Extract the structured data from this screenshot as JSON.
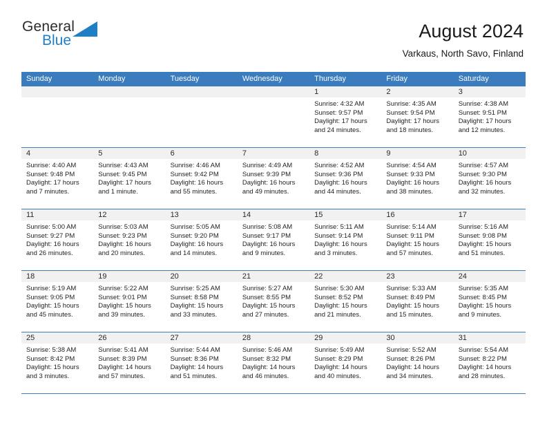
{
  "brand": {
    "name_top": "General",
    "name_bottom": "Blue",
    "triangle_color": "#1f7fc4",
    "text_color": "#2b2b2b"
  },
  "header": {
    "title": "August 2024",
    "subtitle": "Varkaus, North Savo, Finland"
  },
  "theme": {
    "header_blue": "#3a7cbe",
    "date_band_gray": "#f1f1f1",
    "row_border": "#3a7cbe"
  },
  "weekdays": [
    "Sunday",
    "Monday",
    "Tuesday",
    "Wednesday",
    "Thursday",
    "Friday",
    "Saturday"
  ],
  "weeks": [
    [
      {
        "empty": true
      },
      {
        "empty": true
      },
      {
        "empty": true
      },
      {
        "empty": true
      },
      {
        "date": "1",
        "sunrise": "Sunrise: 4:32 AM",
        "sunset": "Sunset: 9:57 PM",
        "daylight1": "Daylight: 17 hours",
        "daylight2": "and 24 minutes."
      },
      {
        "date": "2",
        "sunrise": "Sunrise: 4:35 AM",
        "sunset": "Sunset: 9:54 PM",
        "daylight1": "Daylight: 17 hours",
        "daylight2": "and 18 minutes."
      },
      {
        "date": "3",
        "sunrise": "Sunrise: 4:38 AM",
        "sunset": "Sunset: 9:51 PM",
        "daylight1": "Daylight: 17 hours",
        "daylight2": "and 12 minutes."
      }
    ],
    [
      {
        "date": "4",
        "sunrise": "Sunrise: 4:40 AM",
        "sunset": "Sunset: 9:48 PM",
        "daylight1": "Daylight: 17 hours",
        "daylight2": "and 7 minutes."
      },
      {
        "date": "5",
        "sunrise": "Sunrise: 4:43 AM",
        "sunset": "Sunset: 9:45 PM",
        "daylight1": "Daylight: 17 hours",
        "daylight2": "and 1 minute."
      },
      {
        "date": "6",
        "sunrise": "Sunrise: 4:46 AM",
        "sunset": "Sunset: 9:42 PM",
        "daylight1": "Daylight: 16 hours",
        "daylight2": "and 55 minutes."
      },
      {
        "date": "7",
        "sunrise": "Sunrise: 4:49 AM",
        "sunset": "Sunset: 9:39 PM",
        "daylight1": "Daylight: 16 hours",
        "daylight2": "and 49 minutes."
      },
      {
        "date": "8",
        "sunrise": "Sunrise: 4:52 AM",
        "sunset": "Sunset: 9:36 PM",
        "daylight1": "Daylight: 16 hours",
        "daylight2": "and 44 minutes."
      },
      {
        "date": "9",
        "sunrise": "Sunrise: 4:54 AM",
        "sunset": "Sunset: 9:33 PM",
        "daylight1": "Daylight: 16 hours",
        "daylight2": "and 38 minutes."
      },
      {
        "date": "10",
        "sunrise": "Sunrise: 4:57 AM",
        "sunset": "Sunset: 9:30 PM",
        "daylight1": "Daylight: 16 hours",
        "daylight2": "and 32 minutes."
      }
    ],
    [
      {
        "date": "11",
        "sunrise": "Sunrise: 5:00 AM",
        "sunset": "Sunset: 9:27 PM",
        "daylight1": "Daylight: 16 hours",
        "daylight2": "and 26 minutes."
      },
      {
        "date": "12",
        "sunrise": "Sunrise: 5:03 AM",
        "sunset": "Sunset: 9:23 PM",
        "daylight1": "Daylight: 16 hours",
        "daylight2": "and 20 minutes."
      },
      {
        "date": "13",
        "sunrise": "Sunrise: 5:05 AM",
        "sunset": "Sunset: 9:20 PM",
        "daylight1": "Daylight: 16 hours",
        "daylight2": "and 14 minutes."
      },
      {
        "date": "14",
        "sunrise": "Sunrise: 5:08 AM",
        "sunset": "Sunset: 9:17 PM",
        "daylight1": "Daylight: 16 hours",
        "daylight2": "and 9 minutes."
      },
      {
        "date": "15",
        "sunrise": "Sunrise: 5:11 AM",
        "sunset": "Sunset: 9:14 PM",
        "daylight1": "Daylight: 16 hours",
        "daylight2": "and 3 minutes."
      },
      {
        "date": "16",
        "sunrise": "Sunrise: 5:14 AM",
        "sunset": "Sunset: 9:11 PM",
        "daylight1": "Daylight: 15 hours",
        "daylight2": "and 57 minutes."
      },
      {
        "date": "17",
        "sunrise": "Sunrise: 5:16 AM",
        "sunset": "Sunset: 9:08 PM",
        "daylight1": "Daylight: 15 hours",
        "daylight2": "and 51 minutes."
      }
    ],
    [
      {
        "date": "18",
        "sunrise": "Sunrise: 5:19 AM",
        "sunset": "Sunset: 9:05 PM",
        "daylight1": "Daylight: 15 hours",
        "daylight2": "and 45 minutes."
      },
      {
        "date": "19",
        "sunrise": "Sunrise: 5:22 AM",
        "sunset": "Sunset: 9:01 PM",
        "daylight1": "Daylight: 15 hours",
        "daylight2": "and 39 minutes."
      },
      {
        "date": "20",
        "sunrise": "Sunrise: 5:25 AM",
        "sunset": "Sunset: 8:58 PM",
        "daylight1": "Daylight: 15 hours",
        "daylight2": "and 33 minutes."
      },
      {
        "date": "21",
        "sunrise": "Sunrise: 5:27 AM",
        "sunset": "Sunset: 8:55 PM",
        "daylight1": "Daylight: 15 hours",
        "daylight2": "and 27 minutes."
      },
      {
        "date": "22",
        "sunrise": "Sunrise: 5:30 AM",
        "sunset": "Sunset: 8:52 PM",
        "daylight1": "Daylight: 15 hours",
        "daylight2": "and 21 minutes."
      },
      {
        "date": "23",
        "sunrise": "Sunrise: 5:33 AM",
        "sunset": "Sunset: 8:49 PM",
        "daylight1": "Daylight: 15 hours",
        "daylight2": "and 15 minutes."
      },
      {
        "date": "24",
        "sunrise": "Sunrise: 5:35 AM",
        "sunset": "Sunset: 8:45 PM",
        "daylight1": "Daylight: 15 hours",
        "daylight2": "and 9 minutes."
      }
    ],
    [
      {
        "date": "25",
        "sunrise": "Sunrise: 5:38 AM",
        "sunset": "Sunset: 8:42 PM",
        "daylight1": "Daylight: 15 hours",
        "daylight2": "and 3 minutes."
      },
      {
        "date": "26",
        "sunrise": "Sunrise: 5:41 AM",
        "sunset": "Sunset: 8:39 PM",
        "daylight1": "Daylight: 14 hours",
        "daylight2": "and 57 minutes."
      },
      {
        "date": "27",
        "sunrise": "Sunrise: 5:44 AM",
        "sunset": "Sunset: 8:36 PM",
        "daylight1": "Daylight: 14 hours",
        "daylight2": "and 51 minutes."
      },
      {
        "date": "28",
        "sunrise": "Sunrise: 5:46 AM",
        "sunset": "Sunset: 8:32 PM",
        "daylight1": "Daylight: 14 hours",
        "daylight2": "and 46 minutes."
      },
      {
        "date": "29",
        "sunrise": "Sunrise: 5:49 AM",
        "sunset": "Sunset: 8:29 PM",
        "daylight1": "Daylight: 14 hours",
        "daylight2": "and 40 minutes."
      },
      {
        "date": "30",
        "sunrise": "Sunrise: 5:52 AM",
        "sunset": "Sunset: 8:26 PM",
        "daylight1": "Daylight: 14 hours",
        "daylight2": "and 34 minutes."
      },
      {
        "date": "31",
        "sunrise": "Sunrise: 5:54 AM",
        "sunset": "Sunset: 8:22 PM",
        "daylight1": "Daylight: 14 hours",
        "daylight2": "and 28 minutes."
      }
    ]
  ]
}
